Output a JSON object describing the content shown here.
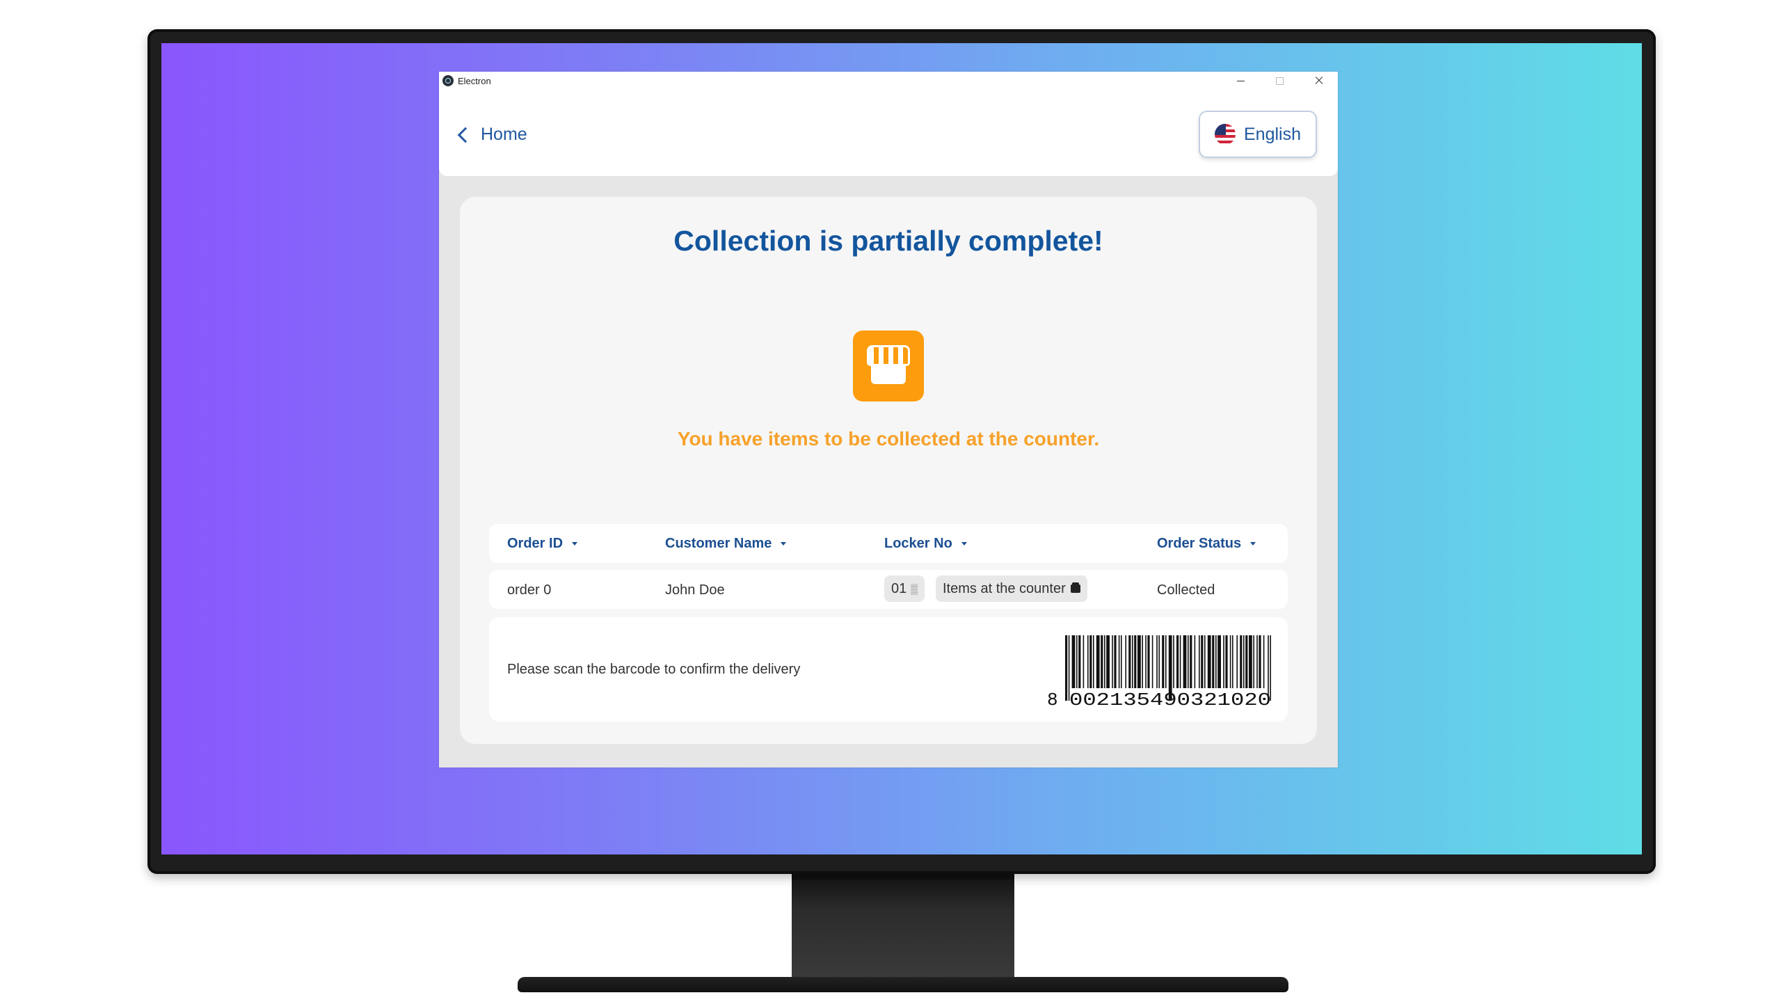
{
  "window": {
    "app_title": "Electron"
  },
  "header": {
    "back_label": "Home",
    "language_label": "English",
    "language_flag": "us-flag-icon"
  },
  "main": {
    "title": "Collection is partially complete!",
    "icon": "store-icon",
    "subtitle": "You have items to be collected at the counter.",
    "accent_color": "#fd9c0d",
    "title_color": "#13559d"
  },
  "table": {
    "columns": [
      "Order ID",
      "Customer Name",
      "Locker No",
      "Order Status"
    ],
    "rows": [
      {
        "order_id": "order 0",
        "customer_name": "John Doe",
        "locker_no": "01",
        "locker_note": "Items at the counter",
        "order_status": "Collected"
      }
    ]
  },
  "scan": {
    "instruction": "Please scan the barcode to confirm the delivery",
    "barcode_first_digit": "8",
    "barcode_digits": "002135490321020"
  }
}
